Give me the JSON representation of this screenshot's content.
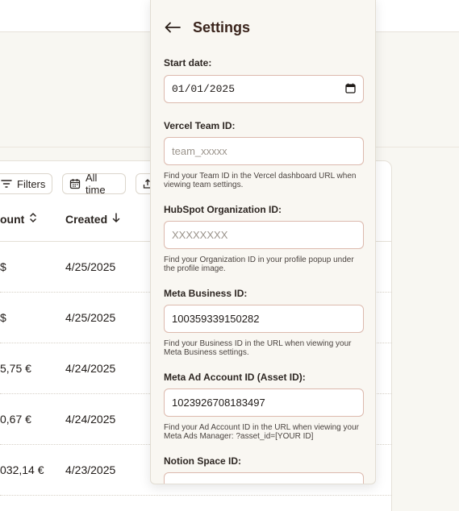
{
  "toolbar": {
    "filters_label": "Filters",
    "date_range_label": "All time"
  },
  "table": {
    "columns": {
      "amount": "ount",
      "created": "Created"
    },
    "rows": [
      {
        "amount": "$",
        "created": "4/25/2025"
      },
      {
        "amount": "$",
        "created": "4/25/2025"
      },
      {
        "amount": "5,75 €",
        "created": "4/24/2025"
      },
      {
        "amount": "0,67 €",
        "created": "4/24/2025"
      },
      {
        "amount": "032,14 €",
        "created": "4/23/2025"
      }
    ]
  },
  "settings": {
    "title": "Settings",
    "start_date": {
      "label": "Start date:",
      "value": "01/01/2025"
    },
    "vercel": {
      "label": "Vercel Team ID:",
      "placeholder": "team_xxxxx",
      "help": "Find your Team ID in the Vercel dashboard URL when viewing team settings."
    },
    "hubspot": {
      "label": "HubSpot Organization ID:",
      "placeholder": "XXXXXXXX",
      "help": "Find your Organization ID in your profile popup under the profile image."
    },
    "meta_business": {
      "label": "Meta Business ID:",
      "value": "100359339150282",
      "help": "Find your Business ID in the URL when viewing your Meta Business settings."
    },
    "meta_ad_account": {
      "label": "Meta Ad Account ID (Asset ID):",
      "value": "1023926708183497",
      "help": "Find your Ad Account ID in the URL when viewing your Meta Ads Manager: ?asset_id=[YOUR ID]"
    },
    "notion": {
      "label": "Notion Space ID:"
    }
  }
}
